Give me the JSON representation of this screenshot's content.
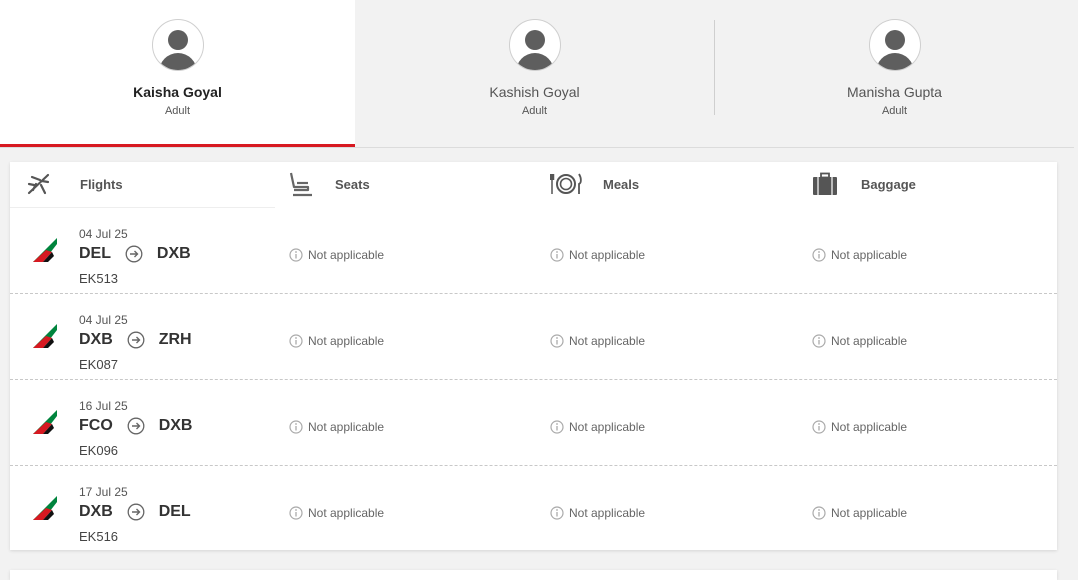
{
  "passengers": [
    {
      "name": "Kaisha Goyal",
      "type": "Adult",
      "active": true
    },
    {
      "name": "Kashish Goyal",
      "type": "Adult",
      "active": false
    },
    {
      "name": "Manisha Gupta",
      "type": "Adult",
      "active": false
    }
  ],
  "columns": {
    "flights": {
      "label": "Flights",
      "icon": "plane-icon"
    },
    "seats": {
      "label": "Seats",
      "icon": "seat-icon"
    },
    "meals": {
      "label": "Meals",
      "icon": "meal-icon"
    },
    "baggage": {
      "label": "Baggage",
      "icon": "baggage-icon"
    }
  },
  "segments": [
    {
      "date": "04 Jul 25",
      "from": "DEL",
      "to": "DXB",
      "flight": "EK513",
      "seats": "Not applicable",
      "meals": "Not applicable",
      "baggage": "Not applicable"
    },
    {
      "date": "04 Jul 25",
      "from": "DXB",
      "to": "ZRH",
      "flight": "EK087",
      "seats": "Not applicable",
      "meals": "Not applicable",
      "baggage": "Not applicable"
    },
    {
      "date": "16 Jul 25",
      "from": "FCO",
      "to": "DXB",
      "flight": "EK096",
      "seats": "Not applicable",
      "meals": "Not applicable",
      "baggage": "Not applicable"
    },
    {
      "date": "17 Jul 25",
      "from": "DXB",
      "to": "DEL",
      "flight": "EK516",
      "seats": "Not applicable",
      "meals": "Not applicable",
      "baggage": "Not applicable"
    }
  ],
  "colors": {
    "accent": "#d71921",
    "tail_green": "#00843d",
    "tail_red": "#d71921"
  }
}
